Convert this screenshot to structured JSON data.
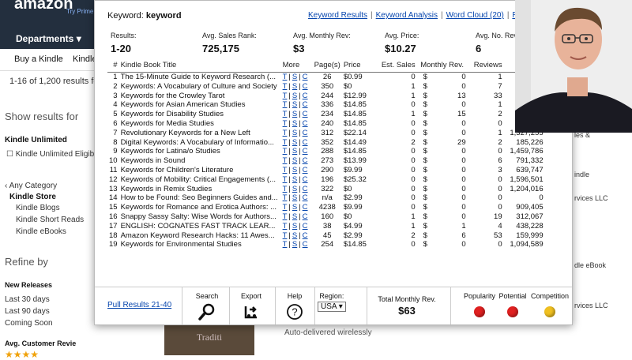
{
  "amazon": {
    "logo": "amazon",
    "prime": "Try Prime",
    "departments": "Departments",
    "nav": [
      "Buy a Kindle",
      "Kindle"
    ],
    "results_text": "1-16 of 1,200 results fo",
    "show_results": "Show results for",
    "kindle_unlimited": "Kindle Unlimited",
    "kindle_unlimited_elig": "Kindle Unlimited Eligib",
    "any_category": "Any Category",
    "kindle_store": "Kindle Store",
    "categories": [
      "Kindle Blogs",
      "Kindle Short Reads",
      "Kindle eBooks"
    ],
    "refine": "Refine by",
    "new_releases": "New Releases",
    "release_opts": [
      "Last 30 days",
      "Last 90 days",
      "Coming Soon"
    ],
    "avg_review": "Avg. Customer Revie",
    "book_text": "Traditi",
    "auto_delivered": "Auto-delivered wirelessly",
    "right_fragments": [
      "les &",
      "indle",
      "rvices LLC",
      "dle eBook",
      "rvices LLC"
    ]
  },
  "popup": {
    "keyword_label": "Keyword:",
    "keyword": "keyword",
    "links": [
      "Keyword Results",
      "Keyword Analysis",
      "Word Cloud (20)",
      "Ra"
    ],
    "stats": [
      {
        "label": "Results:",
        "value": "1-20"
      },
      {
        "label": "Avg. Sales Rank:",
        "value": "725,175"
      },
      {
        "label": "Avg. Monthly Rev:",
        "value": "$3"
      },
      {
        "label": "Avg. Price:",
        "value": "$10.27"
      },
      {
        "label": "Avg. No. Revie",
        "value": "6"
      }
    ],
    "columns": [
      "#",
      "Kindle Book Title",
      "More",
      "Page(s)",
      "Price",
      "Est. Sales",
      "Monthly Rev.",
      "",
      "Reviews",
      "S"
    ],
    "more_links": [
      "T",
      "S",
      "C"
    ],
    "rows": [
      [
        "1",
        "The 15-Minute Guide to Keyword Research (...",
        "26",
        "$0.99",
        "0",
        "$",
        "0",
        "1",
        ""
      ],
      [
        "2",
        "Keywords: A Vocabulary of Culture and Society",
        "350",
        "$0",
        "1",
        "$",
        "0",
        "7",
        ""
      ],
      [
        "3",
        "Keywords for the Crowley Tarot",
        "244",
        "$12.99",
        "1",
        "$",
        "13",
        "33",
        ""
      ],
      [
        "4",
        "Keywords for Asian American Studies",
        "336",
        "$14.85",
        "0",
        "$",
        "0",
        "1",
        ""
      ],
      [
        "5",
        "Keywords for Disability Studies",
        "234",
        "$14.85",
        "1",
        "$",
        "15",
        "2",
        ""
      ],
      [
        "6",
        "Keywords for Media Studies",
        "240",
        "$14.85",
        "0",
        "$",
        "0",
        "0",
        ""
      ],
      [
        "7",
        "Revolutionary Keywords for a New Left",
        "312",
        "$22.14",
        "0",
        "$",
        "0",
        "1",
        "1,327,255"
      ],
      [
        "8",
        "Digital Keywords: A Vocabulary of Informatio...",
        "352",
        "$14.49",
        "2",
        "$",
        "29",
        "2",
        "185,226"
      ],
      [
        "9",
        "Keywords for Latina/o Studies",
        "288",
        "$14.85",
        "0",
        "$",
        "0",
        "0",
        "1,459,786"
      ],
      [
        "10",
        "Keywords in Sound",
        "273",
        "$13.99",
        "0",
        "$",
        "0",
        "6",
        "791,332"
      ],
      [
        "11",
        "Keywords for Children's Literature",
        "290",
        "$9.99",
        "0",
        "$",
        "0",
        "3",
        "639,747"
      ],
      [
        "12",
        "Keywords of Mobility: Critical Engagements (...",
        "196",
        "$25.32",
        "0",
        "$",
        "0",
        "0",
        "1,596,501"
      ],
      [
        "13",
        "Keywords in Remix Studies",
        "322",
        "$0",
        "0",
        "$",
        "0",
        "0",
        "1,204,016"
      ],
      [
        "14",
        "How to be Found: Seo Beginners Guides and...",
        "n/a",
        "$2.99",
        "0",
        "$",
        "0",
        "0",
        "0"
      ],
      [
        "15",
        "Keywords for Romance and Erotica Authors: ...",
        "4238",
        "$9.99",
        "0",
        "$",
        "0",
        "0",
        "909,405"
      ],
      [
        "16",
        "Snappy Sassy Salty: Wise Words for Authors...",
        "160",
        "$0",
        "1",
        "$",
        "0",
        "19",
        "312,067"
      ],
      [
        "17",
        "ENGLISH: COGNATES FAST TRACK LEAR...",
        "38",
        "$4.99",
        "1",
        "$",
        "1",
        "4",
        "438,228"
      ],
      [
        "18",
        "Amazon Keyword Research Hacks: 11 Awes...",
        "45",
        "$2.99",
        "2",
        "$",
        "6",
        "53",
        "159,999"
      ],
      [
        "19",
        "Keywords for Environmental Studies",
        "254",
        "$14.85",
        "0",
        "$",
        "0",
        "0",
        "1,094,589"
      ]
    ],
    "footer": {
      "pull": "Pull Results 21-40",
      "search": "Search",
      "export": "Export",
      "help": "Help",
      "region_label": "Region:",
      "region_value": "USA",
      "total_label": "Total Monthly Rev.",
      "total_value": "$63",
      "popularity": "Popularity",
      "potential": "Potential",
      "competition": "Competition",
      "colors": {
        "popularity": "#e02020",
        "potential": "#e02020",
        "competition": "#f0c020"
      }
    }
  }
}
